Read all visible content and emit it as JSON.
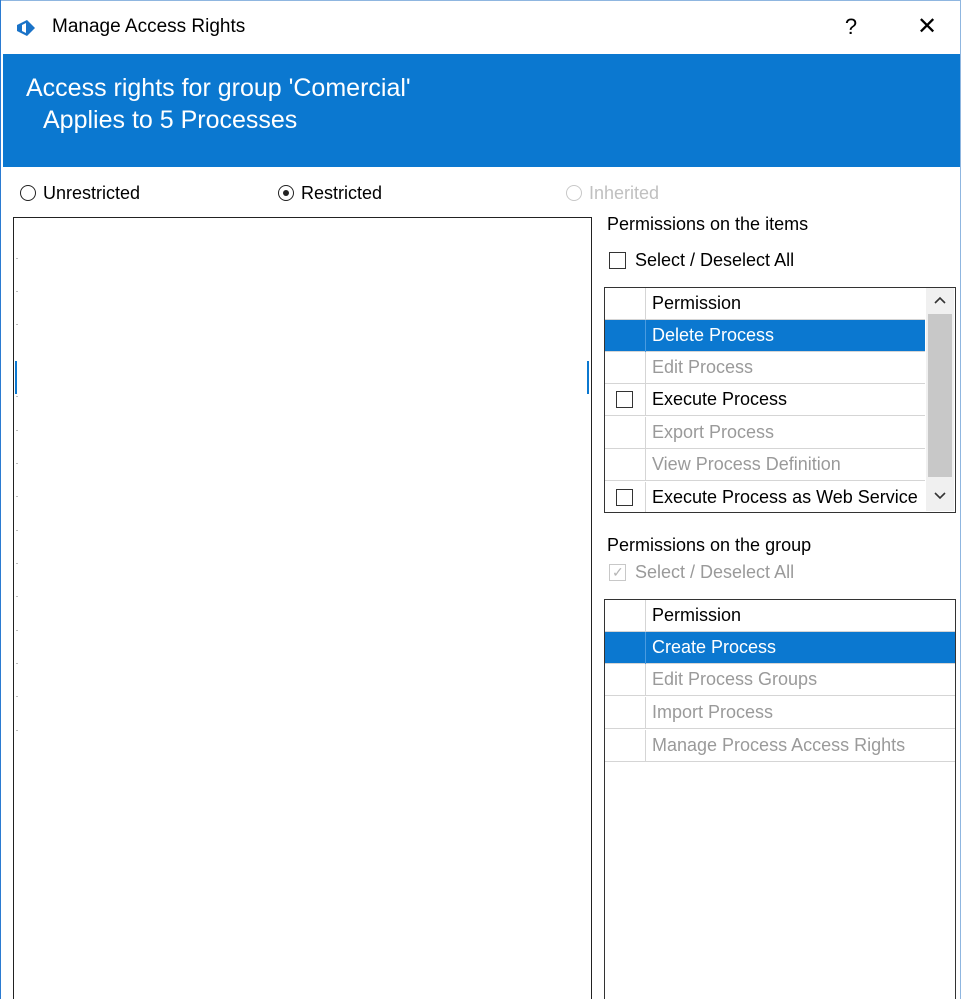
{
  "window": {
    "title": "Manage Access Rights",
    "help_label": "?",
    "close_label": "✕",
    "accent_color": "#0b78d0"
  },
  "header": {
    "line1": "Access rights for group 'Comercial'",
    "line2": "Applies to 5 Processes"
  },
  "access_mode": {
    "options": [
      {
        "label": "Unrestricted",
        "selected": false,
        "enabled": true
      },
      {
        "label": "Restricted",
        "selected": true,
        "enabled": true
      },
      {
        "label": "Inherited",
        "selected": false,
        "enabled": false
      }
    ]
  },
  "items_permissions": {
    "title": "Permissions on the items",
    "select_all_label": "Select / Deselect All",
    "column_header": "Permission",
    "rows": [
      {
        "label": "Delete Process",
        "selected": true,
        "enabled": false
      },
      {
        "label": "Edit Process",
        "selected": false,
        "enabled": false
      },
      {
        "label": "Execute Process",
        "selected": false,
        "enabled": true,
        "checked": false
      },
      {
        "label": "Export Process",
        "selected": false,
        "enabled": false
      },
      {
        "label": "View Process Definition",
        "selected": false,
        "enabled": false
      },
      {
        "label": "Execute Process as Web Service",
        "selected": false,
        "enabled": true,
        "checked": false
      }
    ]
  },
  "group_permissions": {
    "title": "Permissions on the group",
    "select_all_label": "Select / Deselect All",
    "select_all_checked": true,
    "column_header": "Permission",
    "rows": [
      {
        "label": "Create Process",
        "selected": true,
        "enabled": false
      },
      {
        "label": "Edit Process Groups",
        "selected": false,
        "enabled": false
      },
      {
        "label": "Import Process",
        "selected": false,
        "enabled": false
      },
      {
        "label": "Manage Process Access Rights",
        "selected": false,
        "enabled": false
      }
    ]
  },
  "icons": {
    "app": "app-logo-icon",
    "scroll_up": "chevron-up-icon",
    "scroll_down": "chevron-down-icon"
  }
}
